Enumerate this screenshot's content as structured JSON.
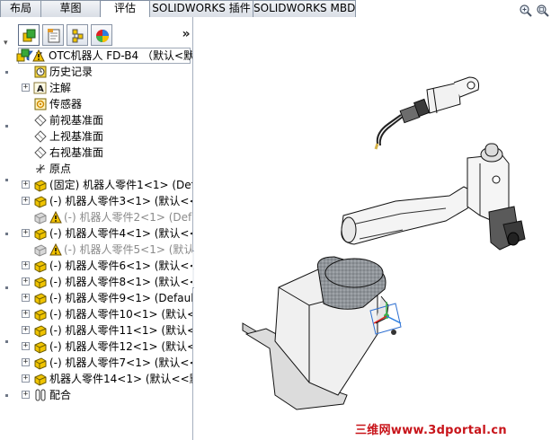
{
  "tabs": [
    {
      "label": "布局"
    },
    {
      "label": "草图"
    },
    {
      "label": "评估",
      "active": true
    },
    {
      "label": "SOLIDWORKS 插件"
    },
    {
      "label": "SOLIDWORKS MBD"
    }
  ],
  "feature_manager": {
    "panel_tabs": [
      "feature-manager-icon",
      "property-manager-icon",
      "configuration-manager-icon",
      "display-manager-icon"
    ],
    "expand_label": "»",
    "filter_icon": "filter-icon"
  },
  "tree": {
    "root": "OTC机器人 FD-B4 （默认<默",
    "items": [
      {
        "label": "历史记录"
      },
      {
        "label": "注解"
      },
      {
        "label": "传感器"
      },
      {
        "label": "前视基准面"
      },
      {
        "label": "上视基准面"
      },
      {
        "label": "右视基准面"
      },
      {
        "label": "原点"
      },
      {
        "label": "(固定) 机器人零件1<1> (Def"
      },
      {
        "label": "(-) 机器人零件3<1> (默认<<"
      },
      {
        "label": "(-) 机器人零件2<1> (Def"
      },
      {
        "label": "(-) 机器人零件4<1> (默认<<"
      },
      {
        "label": "(-) 机器人零件5<1> (默认<"
      },
      {
        "label": "(-) 机器人零件6<1> (默认<<"
      },
      {
        "label": "(-) 机器人零件8<1> (默认<<"
      },
      {
        "label": "(-) 机器人零件9<1> (Defaul"
      },
      {
        "label": "(-) 机器人零件10<1> (默认<<"
      },
      {
        "label": "(-) 机器人零件11<1> (默认<<"
      },
      {
        "label": "(-) 机器人零件12<1> (默认<<"
      },
      {
        "label": "(-) 机器人零件7<1> (默认<<"
      },
      {
        "label": "机器人零件14<1> (默认<<默"
      },
      {
        "label": "配合"
      }
    ]
  },
  "viewport": {
    "tools": [
      "zoom-to-fit-icon",
      "zoom-area-icon"
    ],
    "watermark": "三维网www.3dportal.cn"
  },
  "colors": {
    "tab_border": "#8c98a8",
    "warning": "#f2c200",
    "part_yellow": "#f0c400",
    "watermark": "#c8141a"
  }
}
